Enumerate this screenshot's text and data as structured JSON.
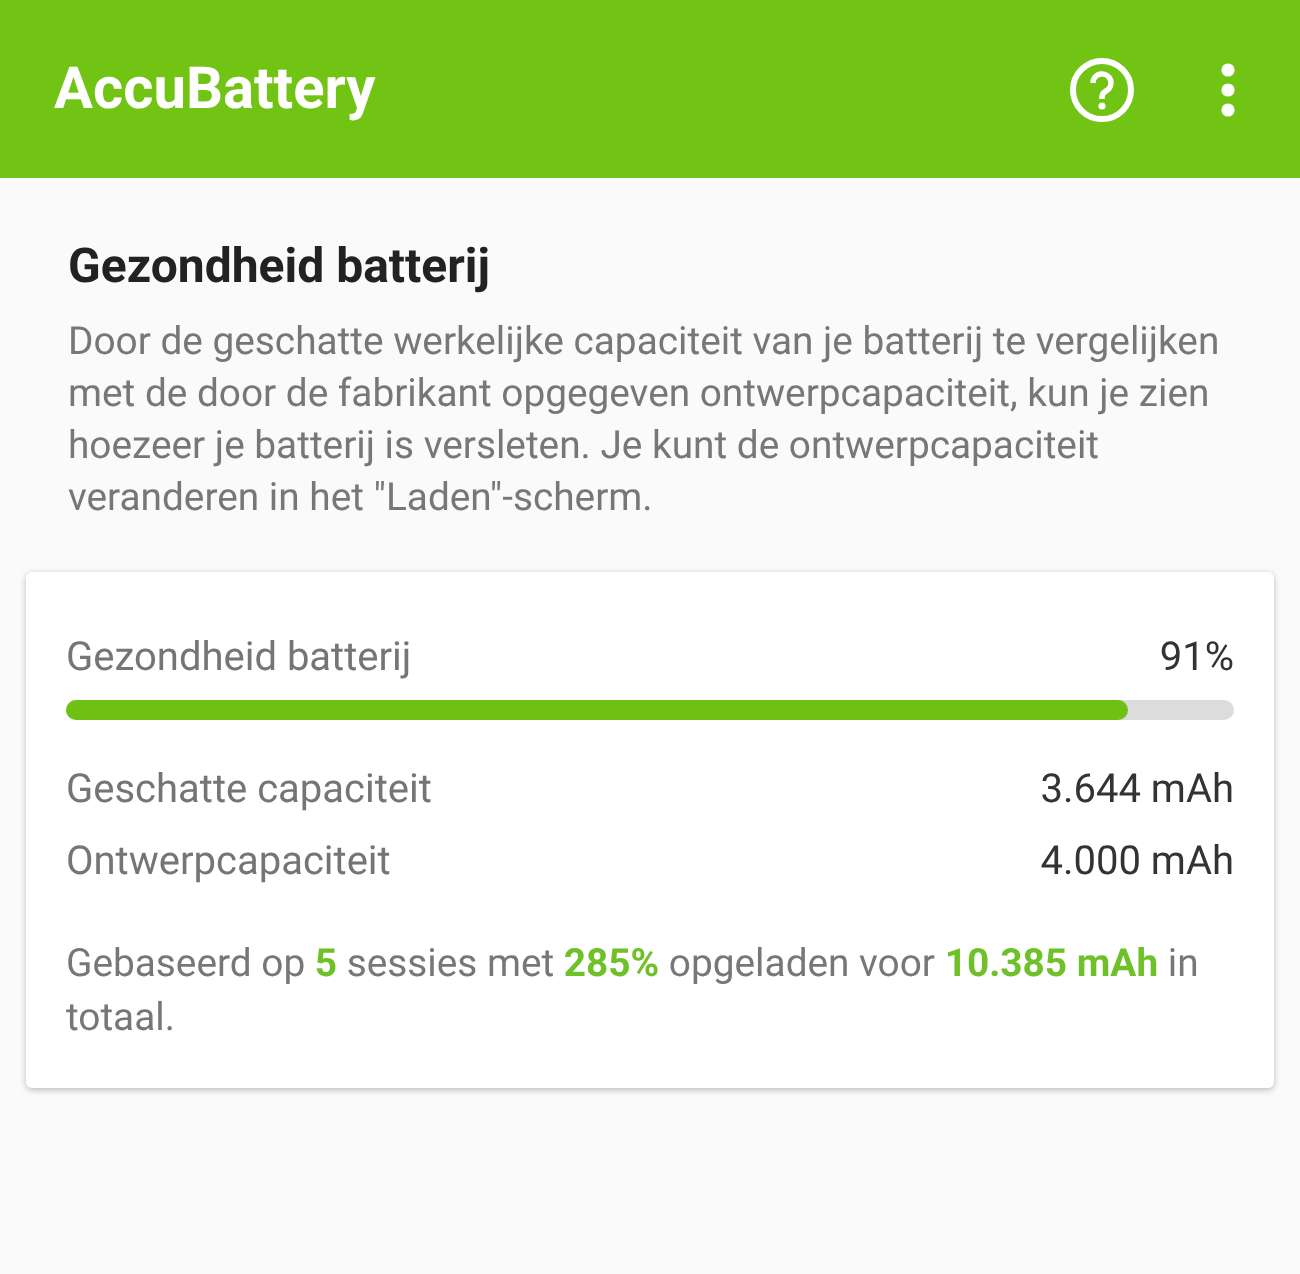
{
  "app_bar": {
    "title": "AccuBattery"
  },
  "section": {
    "title": "Gezondheid batterij",
    "description": "Door de geschatte werkelijke capaciteit van je batterij te vergelijken met de door de fabrikant opgegeven ontwerpcapaciteit, kun je zien hoezeer je batterij is versleten. Je kunt de ontwerpcapaciteit veranderen in het \"Laden\"-scherm."
  },
  "card": {
    "health": {
      "label": "Gezondheid batterij",
      "value": "91%",
      "level": 0.91
    },
    "rows": [
      {
        "label": "Geschatte capaciteit",
        "value": "3.644 mAh"
      },
      {
        "label": "Ontwerpcapaciteit",
        "value": "4.000 mAh"
      }
    ],
    "footnote": "Gebaseerd op **5** sessies met **285%** opgeladen voor **10.385 mAh** in totaal."
  }
}
